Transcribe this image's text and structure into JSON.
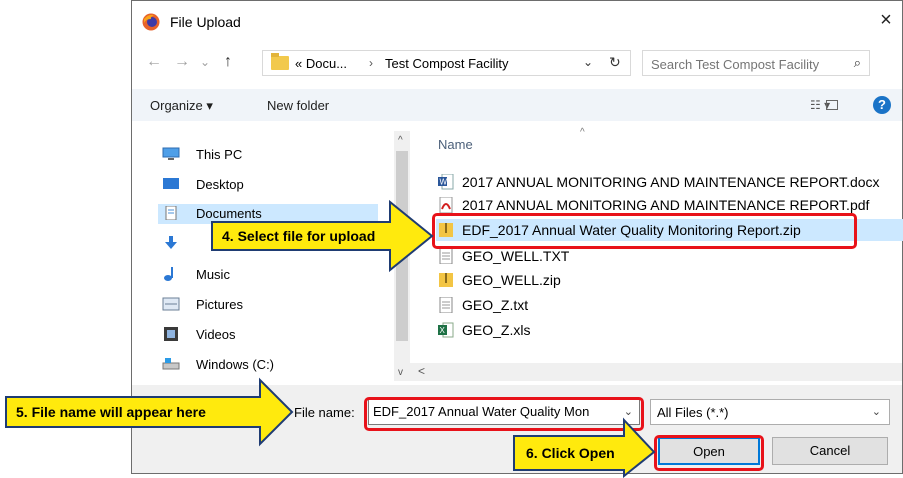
{
  "dialog": {
    "title": "File Upload",
    "close_symbol": "×",
    "icons": {
      "app": "firefox-icon",
      "close": "close-icon"
    }
  },
  "address": {
    "back": "←",
    "forward": "→",
    "recent": "⌄",
    "up": "↑",
    "path_prefix": "« Docu...",
    "separator": "›",
    "current_folder": "Test Compost Facility",
    "dropdown": "⌄",
    "refresh": "↻"
  },
  "search": {
    "placeholder": "Search Test Compost Facility",
    "icon": "⌕"
  },
  "toolbar": {
    "organize_label": "Organize ▾",
    "new_folder_label": "New folder",
    "view_label": "☷ ▾",
    "help_label": "?"
  },
  "nav": {
    "items": [
      {
        "label": "This PC",
        "icon": "pc-icon"
      },
      {
        "label": "Desktop",
        "icon": "desktop-icon"
      },
      {
        "label": "Documents",
        "icon": "documents-icon"
      },
      {
        "label": "",
        "icon": "downloads-icon"
      },
      {
        "label": "Music",
        "icon": "music-icon"
      },
      {
        "label": "Pictures",
        "icon": "pictures-icon"
      },
      {
        "label": "Videos",
        "icon": "videos-icon"
      },
      {
        "label": "Windows (C:)",
        "icon": "drive-icon"
      }
    ],
    "scroll_up": "^",
    "scroll_down": "v",
    "scroll_left": "<"
  },
  "files": {
    "column_name": "Name",
    "sort_indicator": "^",
    "items": [
      {
        "name": "2017 ANNUAL MONITORING AND MAINTENANCE REPORT.docx",
        "icon": "word-doc-icon"
      },
      {
        "name": "2017 ANNUAL MONITORING AND MAINTENANCE REPORT.pdf",
        "icon": "pdf-icon"
      },
      {
        "name": "EDF_2017 Annual Water Quality Monitoring Report.zip",
        "icon": "zip-folder-icon"
      },
      {
        "name": "GEO_WELL.TXT",
        "icon": "text-file-icon"
      },
      {
        "name": "GEO_WELL.zip",
        "icon": "zip-folder-icon"
      },
      {
        "name": "GEO_Z.txt",
        "icon": "text-file-icon"
      },
      {
        "name": "GEO_Z.xls",
        "icon": "excel-icon"
      }
    ]
  },
  "bottom": {
    "file_name_label": "File name:",
    "file_name_value": "EDF_2017 Annual Water Quality Mon",
    "filter_value": "All Files (*.*)",
    "dropdown": "⌄",
    "open_label": "Open",
    "cancel_label": "Cancel"
  },
  "callouts": {
    "step4": "4. Select file for upload",
    "step5": "5. File name will appear here",
    "step6": "6. Click Open"
  },
  "colors": {
    "highlight": "#e8121a",
    "callout_fill": "#ffea0d",
    "callout_border": "#1f3c73",
    "selection": "#cce8ff"
  }
}
